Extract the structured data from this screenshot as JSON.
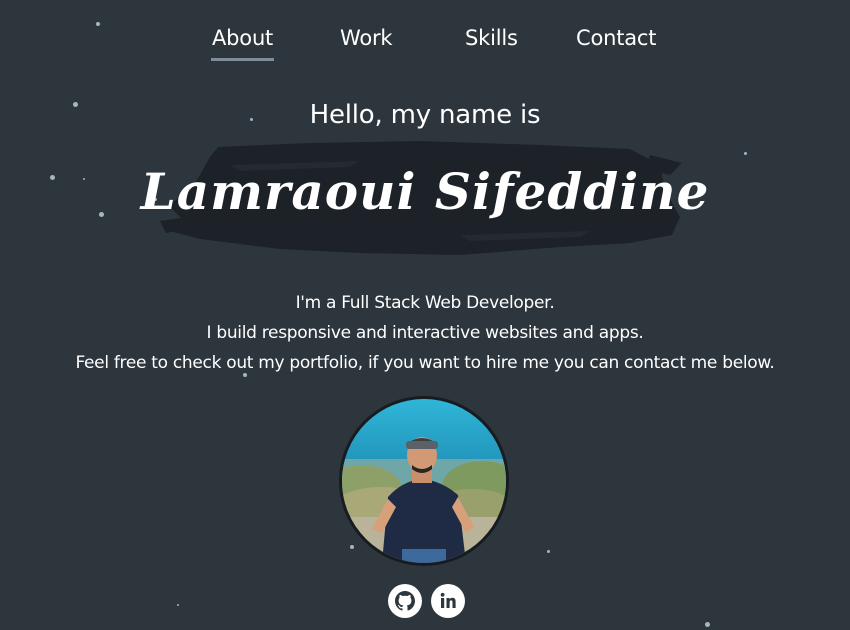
{
  "nav": {
    "items": [
      {
        "label": "About",
        "active": true
      },
      {
        "label": "Work",
        "active": false
      },
      {
        "label": "Skills",
        "active": false
      },
      {
        "label": "Contact",
        "active": false
      }
    ],
    "active_indicator_color": "#7e8d99"
  },
  "hero": {
    "greeting": "Hello, my name is",
    "name": "Lamraoui Sifeddine"
  },
  "bio": {
    "lines": [
      "I'm a Full Stack Web Developer.",
      "I build responsive and interactive websites and apps.",
      "Feel free to check out my portfolio, if you want to hire me you can contact me below."
    ]
  },
  "social": {
    "icons": [
      "github-icon",
      "linkedin-icon"
    ]
  },
  "colors": {
    "background": "#2d363d",
    "brush": "#1c2227",
    "text": "#ffffff"
  }
}
